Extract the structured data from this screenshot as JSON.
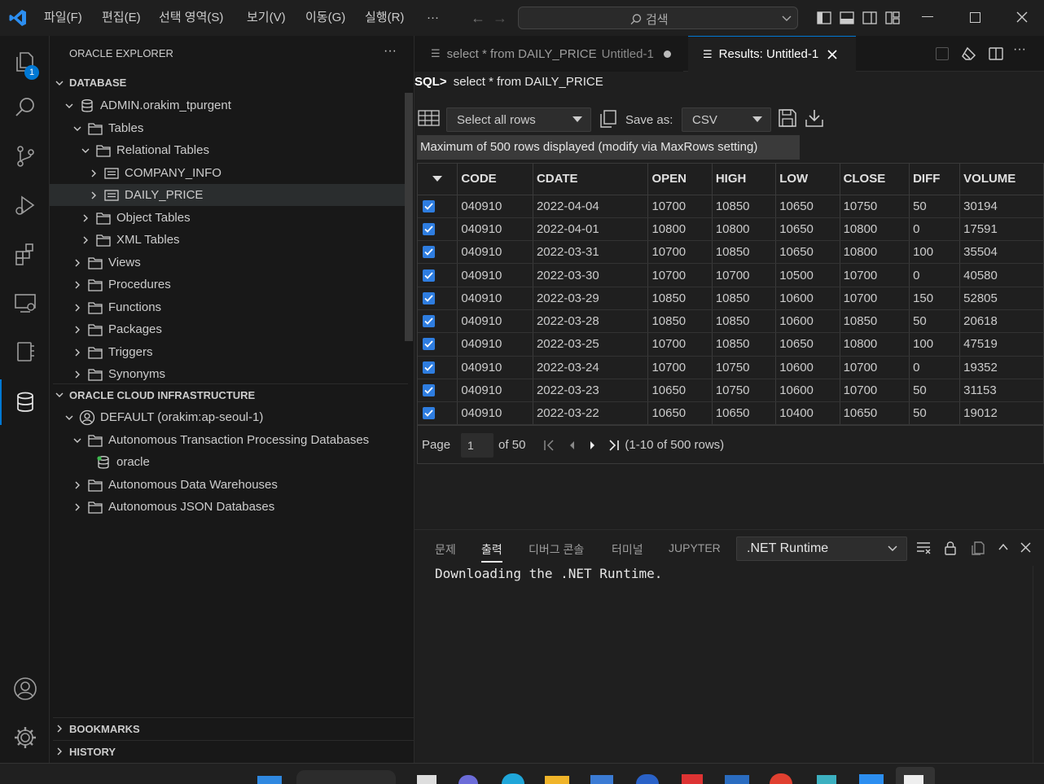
{
  "titlebar": {
    "menus": [
      "파일(F)",
      "편집(E)",
      "선택 영역(S)",
      "보기(V)",
      "이동(G)",
      "실행(R)",
      "···"
    ],
    "search_placeholder": "검색"
  },
  "activity": {
    "badge": "1"
  },
  "sidebar": {
    "title": "ORACLE EXPLORER",
    "more": "···",
    "database_header": "DATABASE",
    "tree": {
      "connection": "ADMIN.orakim_tpurgent",
      "tables": "Tables",
      "relational": "Relational Tables",
      "company_info": "COMPANY_INFO",
      "daily_price": "DAILY_PRICE",
      "object_tables": "Object Tables",
      "xml_tables": "XML Tables",
      "views": "Views",
      "procedures": "Procedures",
      "functions": "Functions",
      "packages": "Packages",
      "triggers": "Triggers",
      "synonyms": "Synonyms"
    },
    "cloud_header": "ORACLE CLOUD INFRASTRUCTURE",
    "cloud": {
      "profile": "DEFAULT (orakim:ap-seoul-1)",
      "atp": "Autonomous Transaction Processing Databases",
      "oracle": "oracle",
      "adw": "Autonomous Data Warehouses",
      "ajd": "Autonomous JSON Databases"
    },
    "bookmarks": "BOOKMARKS",
    "history": "HISTORY"
  },
  "tabs": {
    "query_tab": "select * from DAILY_PRICE",
    "query_tab_suffix": "Untitled-1",
    "results_tab": "Results: Untitled-1"
  },
  "editor": {
    "sql_prefix": "SQL>",
    "sql_text": "select * from DAILY_PRICE",
    "select_rows": "Select all rows",
    "save_as": "Save as:",
    "format": "CSV",
    "max_rows_notice": "Maximum of 500 rows displayed (modify via MaxRows setting)",
    "columns": [
      "CODE",
      "CDATE",
      "OPEN",
      "HIGH",
      "LOW",
      "CLOSE",
      "DIFF",
      "VOLUME"
    ],
    "rows": [
      [
        "040910",
        "2022-04-04",
        "10700",
        "10850",
        "10650",
        "10750",
        "50",
        "30194"
      ],
      [
        "040910",
        "2022-04-01",
        "10800",
        "10800",
        "10650",
        "10800",
        "0",
        "17591"
      ],
      [
        "040910",
        "2022-03-31",
        "10700",
        "10850",
        "10650",
        "10800",
        "100",
        "35504"
      ],
      [
        "040910",
        "2022-03-30",
        "10700",
        "10700",
        "10500",
        "10700",
        "0",
        "40580"
      ],
      [
        "040910",
        "2022-03-29",
        "10850",
        "10850",
        "10600",
        "10700",
        "150",
        "52805"
      ],
      [
        "040910",
        "2022-03-28",
        "10850",
        "10850",
        "10600",
        "10850",
        "50",
        "20618"
      ],
      [
        "040910",
        "2022-03-25",
        "10700",
        "10850",
        "10650",
        "10800",
        "100",
        "47519"
      ],
      [
        "040910",
        "2022-03-24",
        "10700",
        "10750",
        "10600",
        "10700",
        "0",
        "19352"
      ],
      [
        "040910",
        "2022-03-23",
        "10650",
        "10750",
        "10600",
        "10700",
        "50",
        "31153"
      ],
      [
        "040910",
        "2022-03-22",
        "10650",
        "10650",
        "10400",
        "10650",
        "50",
        "19012"
      ]
    ],
    "pager": {
      "page_label": "Page",
      "page_value": "1",
      "of_label": "of 50",
      "range": "(1-10 of 500 rows)"
    }
  },
  "panel": {
    "tabs": [
      "문제",
      "출력",
      "디버그 콘솔",
      "터미널",
      "JUPYTER"
    ],
    "active_tab": "출력",
    "channel": ".NET Runtime",
    "output": "Downloading the .NET Runtime."
  },
  "colors": {
    "accent": "#0078d4",
    "checkbox": "#2e7de0",
    "bg": "#1f1f1f"
  }
}
